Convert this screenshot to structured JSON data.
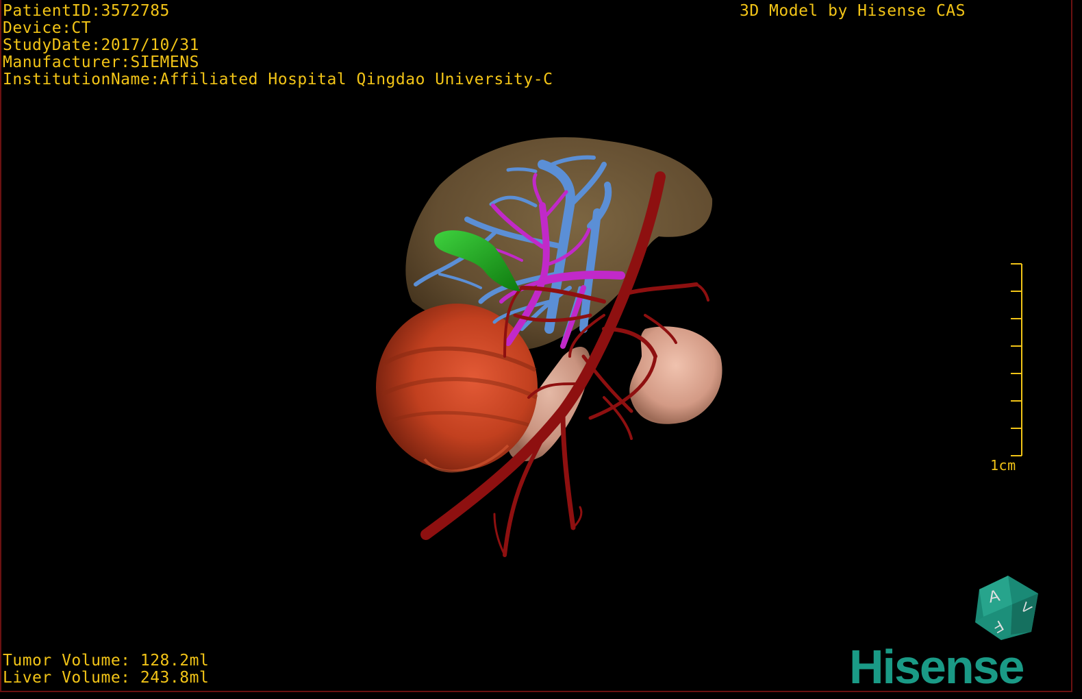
{
  "header": {
    "patient_id": "PatientID:3572785",
    "device": "Device:CT",
    "study_date": "StudyDate:2017/10/31",
    "manufacturer": "Manufacturer:SIEMENS",
    "institution": "InstitutionName:Affiliated Hospital Qingdao University-C",
    "model_title": "3D Model by Hisense CAS"
  },
  "footer": {
    "tumor_volume": "Tumor Volume: 128.2ml",
    "liver_volume": "Liver Volume: 243.8ml"
  },
  "scale_bar": {
    "label": "1cm",
    "tick_count": 8
  },
  "orientation_cube": {
    "face_front": "A",
    "face_bottom": "F",
    "face_right": "V"
  },
  "brand": {
    "logo_text": "Hisense",
    "logo_color": "#1a9a86"
  },
  "colors": {
    "overlay_text": "#f2c417",
    "liver": "#7a6240",
    "tumor": "#c8472c",
    "artery": "#8e1010",
    "portal_vein": "#c129c9",
    "hepatic_vein": "#5b8fd6",
    "gallbladder": "#1b9a1b",
    "kidney": "#d9a897"
  }
}
